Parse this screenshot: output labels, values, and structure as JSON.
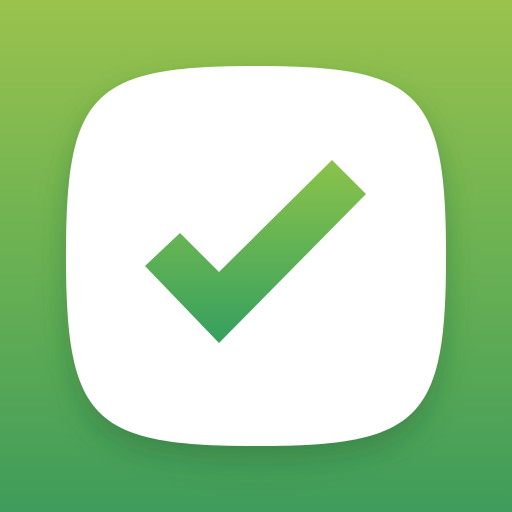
{
  "icon": {
    "name": "checkmark-icon",
    "shape": "squircle",
    "colors": {
      "background_top": "#9ac24d",
      "background_mid": "#6fb352",
      "background_bottom": "#3f9c5a",
      "card": "#ffffff",
      "check_top": "#8bc34a",
      "check_bottom": "#35a05f",
      "shadow": "#1e5a2e"
    }
  }
}
